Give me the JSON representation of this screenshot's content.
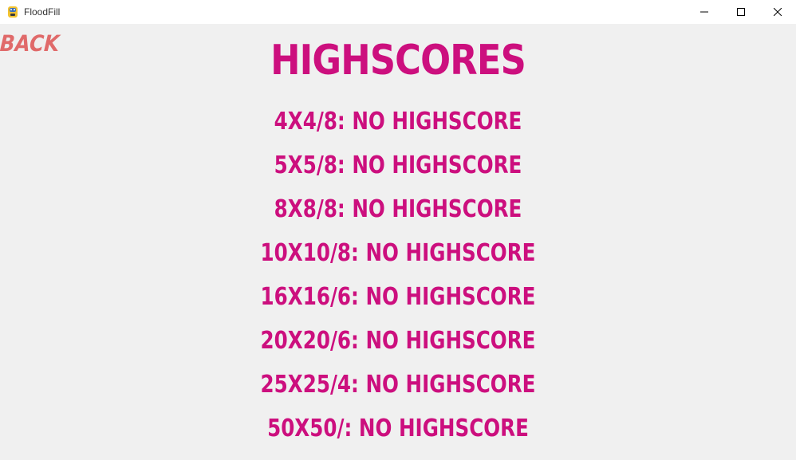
{
  "window": {
    "title": "FloodFill",
    "icons": {
      "app": "python-snake-icon",
      "minimize": "minimize-icon",
      "maximize": "maximize-icon",
      "close": "close-icon"
    }
  },
  "screen": {
    "back_label": "BACK",
    "title": "HIGHSCORES",
    "colors": {
      "background": "#f0f0f0",
      "title": "#cc0f7e",
      "back": "#e06a6a"
    },
    "scores": [
      "4X4/8: NO HIGHSCORE",
      "5X5/8: NO HIGHSCORE",
      "8X8/8: NO HIGHSCORE",
      "10X10/8: NO HIGHSCORE",
      "16X16/6: NO HIGHSCORE",
      "20X20/6: NO HIGHSCORE",
      "25X25/4: NO HIGHSCORE",
      "50X50/: NO HIGHSCORE"
    ]
  }
}
